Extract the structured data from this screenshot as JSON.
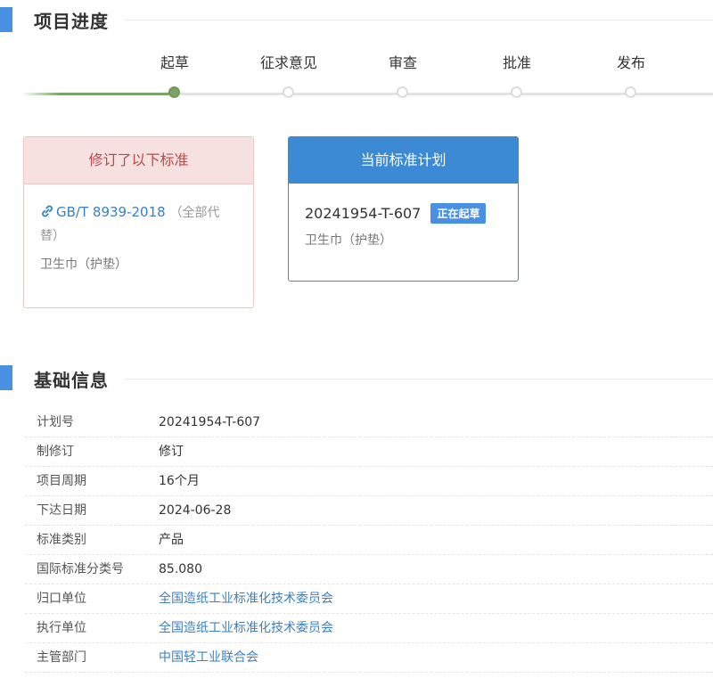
{
  "progress": {
    "title": "项目进度",
    "steps": [
      {
        "label": "起草",
        "active": true
      },
      {
        "label": "征求意见",
        "active": false
      },
      {
        "label": "审查",
        "active": false
      },
      {
        "label": "批准",
        "active": false
      },
      {
        "label": "发布",
        "active": false
      }
    ]
  },
  "revised_card": {
    "title": "修订了以下标准",
    "standard_code": "GB/T 8939-2018",
    "replace_note_1": "（全部代",
    "replace_note_2": "替）",
    "standard_name": "卫生巾（护垫）"
  },
  "plan_card": {
    "title": "当前标准计划",
    "plan_number": "20241954-T-607",
    "status_badge": "正在起草",
    "plan_name": "卫生巾（护垫）"
  },
  "basic_info": {
    "title": "基础信息",
    "rows": [
      {
        "label": "计划号",
        "value": "20241954-T-607",
        "link": false
      },
      {
        "label": "制修订",
        "value": "修订",
        "link": false
      },
      {
        "label": "项目周期",
        "value": "16个月",
        "link": false
      },
      {
        "label": "下达日期",
        "value": "2024-06-28",
        "link": false
      },
      {
        "label": "标准类别",
        "value": "产品",
        "link": false
      },
      {
        "label": "国际标准分类号",
        "value": "85.080",
        "link": false
      },
      {
        "label": "归口单位",
        "value": "全国造纸工业标准化技术委员会",
        "link": true
      },
      {
        "label": "执行单位",
        "value": "全国造纸工业标准化技术委员会",
        "link": true
      },
      {
        "label": "主管部门",
        "value": "中国轻工业联合会",
        "link": true
      }
    ]
  },
  "colors": {
    "accent_blue": "#4a90e2",
    "progress_green": "#7aa465",
    "link_blue": "#3b7fc4",
    "revised_red": "#b84b4b"
  }
}
